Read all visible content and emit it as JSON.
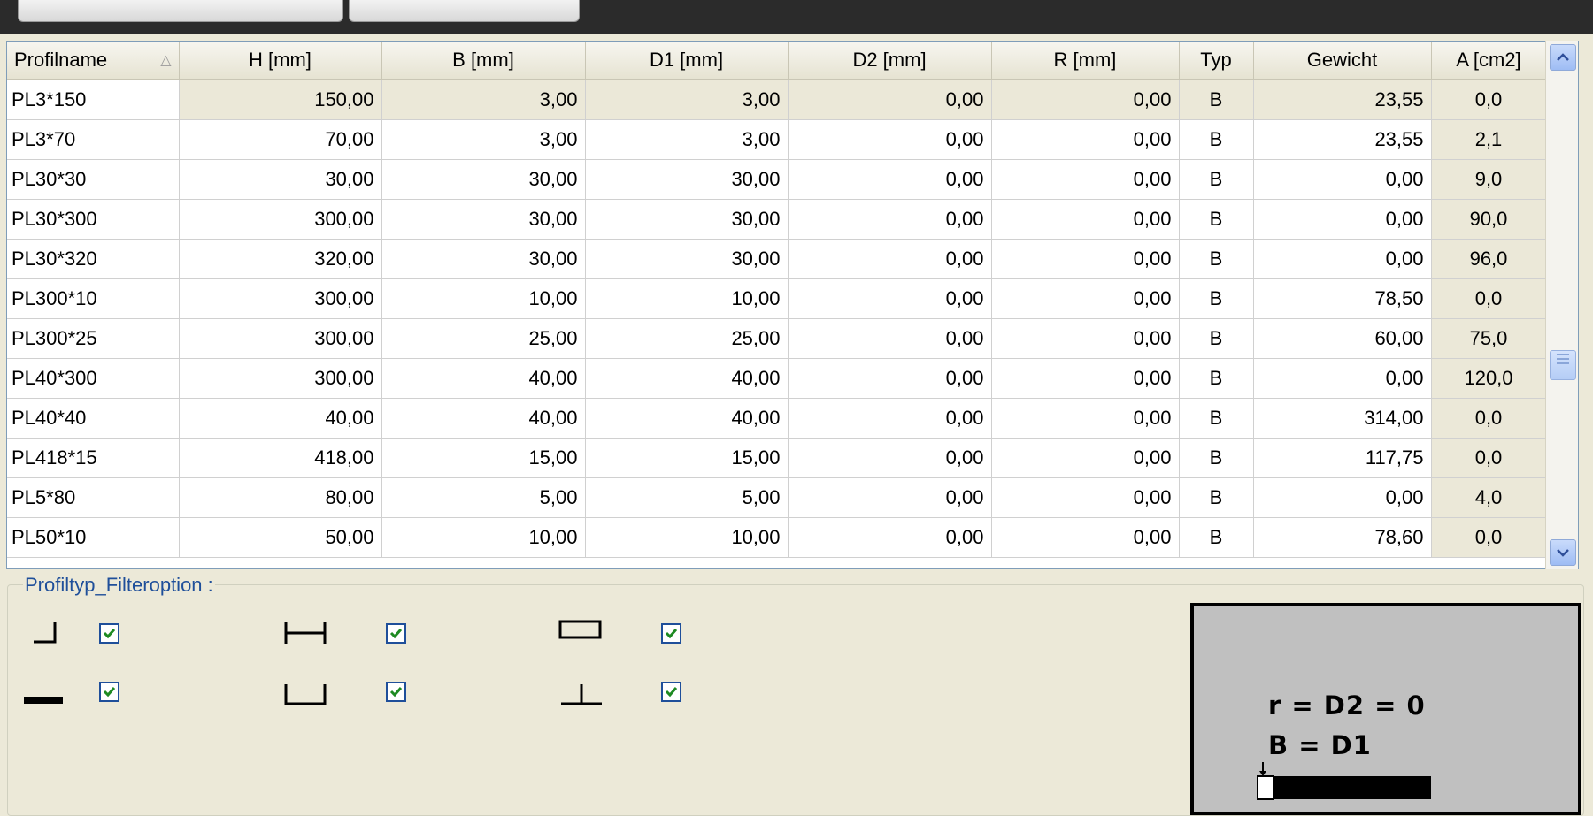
{
  "table": {
    "columns": [
      "Profilname",
      "H [mm]",
      "B [mm]",
      "D1 [mm]",
      "D2 [mm]",
      "R [mm]",
      "Typ",
      "Gewicht",
      "A [cm2]"
    ],
    "sort_indicator": "△",
    "rows": [
      [
        "PL3*150",
        "150,00",
        "3,00",
        "3,00",
        "0,00",
        "0,00",
        "B",
        "23,55",
        "0,0"
      ],
      [
        "PL3*70",
        "70,00",
        "3,00",
        "3,00",
        "0,00",
        "0,00",
        "B",
        "23,55",
        "2,1"
      ],
      [
        "PL30*30",
        "30,00",
        "30,00",
        "30,00",
        "0,00",
        "0,00",
        "B",
        "0,00",
        "9,0"
      ],
      [
        "PL30*300",
        "300,00",
        "30,00",
        "30,00",
        "0,00",
        "0,00",
        "B",
        "0,00",
        "90,0"
      ],
      [
        "PL30*320",
        "320,00",
        "30,00",
        "30,00",
        "0,00",
        "0,00",
        "B",
        "0,00",
        "96,0"
      ],
      [
        "PL300*10",
        "300,00",
        "10,00",
        "10,00",
        "0,00",
        "0,00",
        "B",
        "78,50",
        "0,0"
      ],
      [
        "PL300*25",
        "300,00",
        "25,00",
        "25,00",
        "0,00",
        "0,00",
        "B",
        "60,00",
        "75,0"
      ],
      [
        "PL40*300",
        "300,00",
        "40,00",
        "40,00",
        "0,00",
        "0,00",
        "B",
        "0,00",
        "120,0"
      ],
      [
        "PL40*40",
        "40,00",
        "40,00",
        "40,00",
        "0,00",
        "0,00",
        "B",
        "314,00",
        "0,0"
      ],
      [
        "PL418*15",
        "418,00",
        "15,00",
        "15,00",
        "0,00",
        "0,00",
        "B",
        "117,75",
        "0,0"
      ],
      [
        "PL5*80",
        "80,00",
        "5,00",
        "5,00",
        "0,00",
        "0,00",
        "B",
        "0,00",
        "4,0"
      ],
      [
        "PL50*10",
        "50,00",
        "10,00",
        "10,00",
        "0,00",
        "0,00",
        "B",
        "78,60",
        "0,0"
      ]
    ]
  },
  "filter": {
    "legend": "Profiltyp_Filteroption :",
    "options": [
      {
        "icon": "angle-profile-icon",
        "checked": true
      },
      {
        "icon": "i-beam-profile-icon",
        "checked": true
      },
      {
        "icon": "box-profile-icon",
        "checked": true
      },
      {
        "icon": "flat-bar-profile-icon",
        "checked": true
      },
      {
        "icon": "channel-profile-icon",
        "checked": true
      },
      {
        "icon": "t-profile-icon",
        "checked": true
      }
    ]
  },
  "preview": {
    "line1": "r = D2 = 0",
    "line2": "B = D1"
  },
  "colors": {
    "background": "#ece9d8",
    "accent": "#1f4f9a",
    "topbar": "#2b2b2b"
  }
}
